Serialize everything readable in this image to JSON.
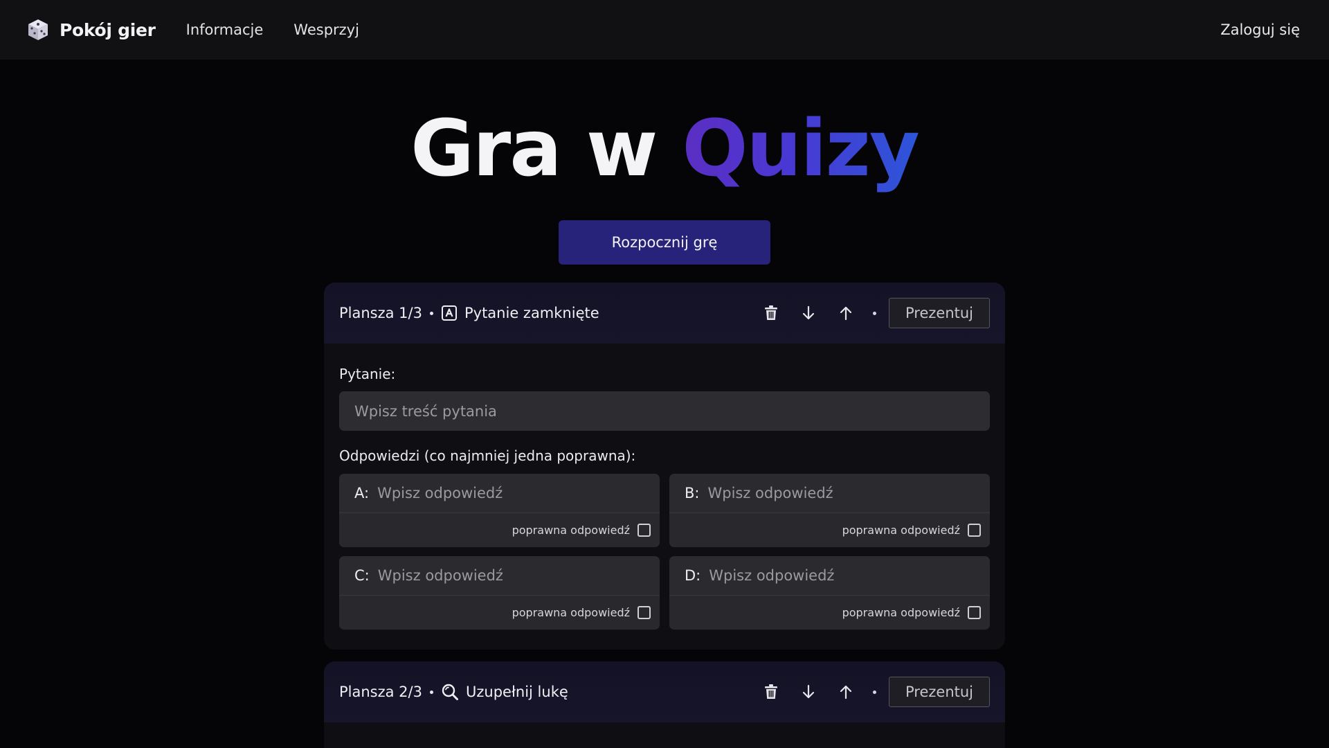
{
  "navbar": {
    "brand": "Pokój gier",
    "links": [
      "Informacje",
      "Wesprzyj"
    ],
    "login": "Zaloguj się"
  },
  "hero": {
    "title_white": "Gra w ",
    "title_accent": "Quizy",
    "start_button": "Rozpocznij grę"
  },
  "colors": {
    "accent_start": "#5b2ec2",
    "accent_end": "#2d55d8",
    "start_button": "#28237a"
  },
  "boards": [
    {
      "label": "Plansza 1/3",
      "type_label": "Pytanie zamknięte",
      "type_icon": "letter-a-box-icon",
      "present_button": "Prezentuj",
      "question_label": "Pytanie:",
      "question_placeholder": "Wpisz treść pytania",
      "answers_label": "Odpowiedzi (co najmniej jedna poprawna):",
      "answers": [
        {
          "letter": "A:",
          "placeholder": "Wpisz odpowiedź",
          "correct_label": "poprawna odpowiedź",
          "correct": false
        },
        {
          "letter": "B:",
          "placeholder": "Wpisz odpowiedź",
          "correct_label": "poprawna odpowiedź",
          "correct": false
        },
        {
          "letter": "C:",
          "placeholder": "Wpisz odpowiedź",
          "correct_label": "poprawna odpowiedź",
          "correct": false
        },
        {
          "letter": "D:",
          "placeholder": "Wpisz odpowiedź",
          "correct_label": "poprawna odpowiedź",
          "correct": false
        }
      ]
    },
    {
      "label": "Plansza 2/3",
      "type_label": "Uzupełnij lukę",
      "type_icon": "magnifier-icon",
      "present_button": "Prezentuj"
    }
  ]
}
